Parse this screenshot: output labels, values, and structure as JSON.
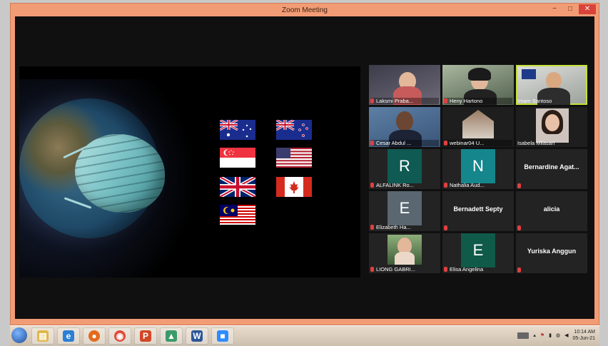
{
  "window": {
    "title": "Zoom Meeting"
  },
  "controls": {
    "minimize": "−",
    "maximize": "□",
    "close": "✕"
  },
  "participants": [
    {
      "name": "Laksmi Praba...",
      "kind": "video",
      "active": false,
      "muted": true
    },
    {
      "name": "Heny Hartono",
      "kind": "video",
      "active": false,
      "muted": true
    },
    {
      "name": "Imam Santoso",
      "kind": "video",
      "active": true,
      "muted": false
    },
    {
      "name": "Cesar Abdul ...",
      "kind": "video",
      "active": false,
      "muted": true
    },
    {
      "name": "webinar04 U...",
      "kind": "video",
      "active": false,
      "muted": true
    },
    {
      "name": "Isabela Milasari",
      "kind": "video",
      "active": false,
      "muted": false
    },
    {
      "name": "ALFALINK Ro...",
      "kind": "letter",
      "letter": "R",
      "letter_color": "#0f5a52",
      "muted": true
    },
    {
      "name": "Nathalia Aud...",
      "kind": "letter",
      "letter": "N",
      "letter_color": "#14868c",
      "muted": true
    },
    {
      "name": "Bernardine Agat...",
      "kind": "text",
      "muted": true
    },
    {
      "name": "Elizabeth Ha...",
      "kind": "letter",
      "letter": "E",
      "letter_color": "#5a6670",
      "muted": true
    },
    {
      "name": "Bernadett Septy",
      "kind": "text",
      "muted": true
    },
    {
      "name": "alicia",
      "kind": "text",
      "muted": true
    },
    {
      "name": "LIONG GABRI...",
      "kind": "video",
      "active": false,
      "muted": true
    },
    {
      "name": "Elisa Angelina",
      "kind": "letter",
      "letter": "E",
      "letter_color": "#0f5a48",
      "muted": true
    },
    {
      "name": "Yuriska Anggun",
      "kind": "text",
      "muted": true
    }
  ],
  "flags": [
    "australia",
    "new-zealand",
    "singapore",
    "usa",
    "united-kingdom",
    "canada",
    "malaysia"
  ],
  "taskbar": {
    "apps": [
      {
        "name": "file-explorer",
        "color": "#e0b84a",
        "glyph": "▤"
      },
      {
        "name": "internet-explorer",
        "color": "#2c7fd6",
        "glyph": "e"
      },
      {
        "name": "firefox",
        "color": "#e46a1c",
        "glyph": "●"
      },
      {
        "name": "chrome",
        "color": "#e04a3a",
        "glyph": "◉"
      },
      {
        "name": "powerpoint",
        "color": "#d24726",
        "glyph": "P"
      },
      {
        "name": "image-viewer",
        "color": "#3c9a6a",
        "glyph": "▲"
      },
      {
        "name": "word",
        "color": "#2b5797",
        "glyph": "W"
      },
      {
        "name": "zoom",
        "color": "#2d8cff",
        "glyph": "■"
      }
    ],
    "time": "10:14 AM",
    "date": "05-Jun-21"
  },
  "colors": {
    "window_frame": "#f29c76",
    "active_speaker": "#c4e13b",
    "muted_mic": "#e04040"
  }
}
